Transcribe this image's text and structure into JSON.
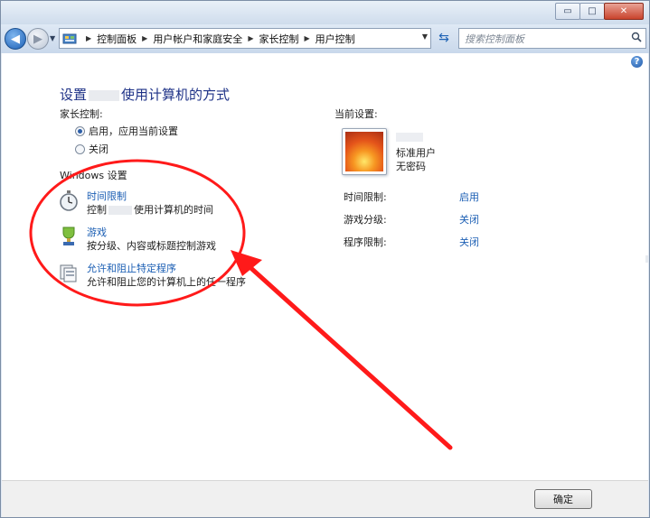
{
  "window": {
    "controls": {
      "minimize": "▭",
      "maximize": "□",
      "close": "✕"
    }
  },
  "navbar": {
    "back_icon": "back-arrow-icon",
    "forward_icon": "forward-arrow-icon",
    "breadcrumbs": [
      "控制面板",
      "用户帐户和家庭安全",
      "家长控制",
      "用户控制"
    ],
    "search_placeholder": "搜索控制面板"
  },
  "main": {
    "title_prefix": "设置",
    "title_suffix": "使用计算机的方式",
    "parental_control_label": "家长控制:",
    "radio_on": "启用，应用当前设置",
    "radio_off": "关闭",
    "selected": "启用，应用当前设置",
    "windows_settings_label": "Windows 设置",
    "settings": [
      {
        "icon": "stopwatch-icon",
        "title": "时间限制",
        "desc_prefix": "控制",
        "desc_suffix": "使用计算机的时间"
      },
      {
        "icon": "trophy-icon",
        "title": "游戏",
        "desc": "按分级、内容或标题控制游戏"
      },
      {
        "icon": "programs-icon",
        "title": "允许和阻止特定程序",
        "desc": "允许和阻止您的计算机上的任一程序"
      }
    ]
  },
  "current": {
    "label": "当前设置:",
    "account_type": "标准用户",
    "password": "无密码",
    "rows": [
      {
        "label": "时间限制:",
        "value": "启用"
      },
      {
        "label": "游戏分级:",
        "value": "关闭"
      },
      {
        "label": "程序限制:",
        "value": "关闭"
      }
    ]
  },
  "footer": {
    "ok_label": "确定"
  },
  "colors": {
    "link": "#1c5fb4",
    "title": "#1e3287",
    "annotation": "#ff1a1a"
  }
}
